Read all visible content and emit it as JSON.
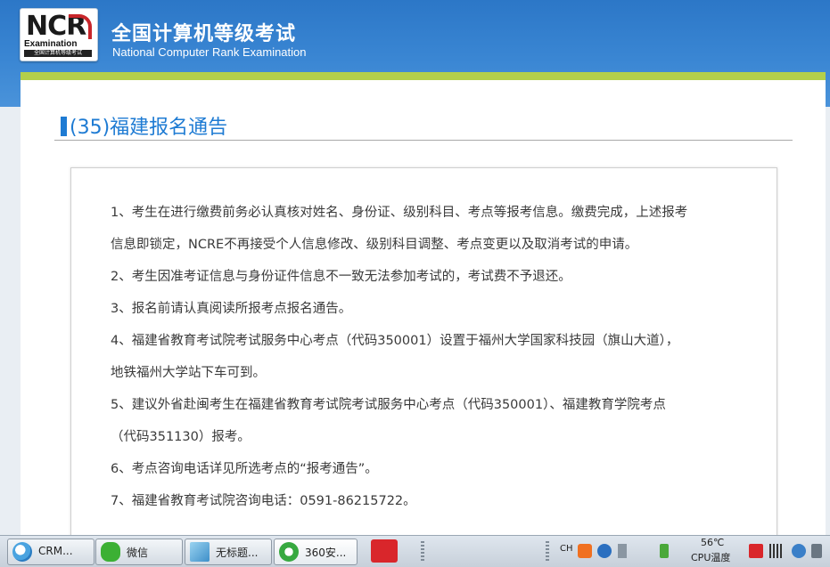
{
  "header": {
    "logo_text": "NCR",
    "logo_sub": "Examination",
    "logo_strip": "全国计算机等级考试",
    "title_cn": "全国计算机等级考试",
    "title_en": "National Computer Rank Examination"
  },
  "page": {
    "title": "(35)福建报名通告"
  },
  "notice": {
    "lines": [
      "1、考生在进行缴费前务必认真核对姓名、身份证、级别科目、考点等报考信息。缴费完成，上述报考",
      "信息即锁定，NCRE不再接受个人信息修改、级别科目调整、考点变更以及取消考试的申请。",
      "2、考生因准考证信息与身份证件信息不一致无法参加考试的，考试费不予退还。",
      "3、报名前请认真阅读所报考点报名通告。",
      "4、福建省教育考试院考试服务中心考点（代码350001）设置于福州大学国家科技园（旗山大道），",
      "地铁福州大学站下车可到。",
      "5、建议外省赴闽考生在福建省教育考试院考试服务中心考点（代码350001）、福建教育学院考点",
      "（代码351130）报考。",
      "6、考点咨询电话详见所选考点的“报考通告”。",
      "7、福建省教育考试院咨询电话：0591-86215722。"
    ]
  },
  "taskbar": {
    "items": [
      {
        "label": "CRM...",
        "icon": "crm-icon"
      },
      {
        "label": "微信",
        "icon": "wechat-icon"
      },
      {
        "label": "无标题...",
        "icon": "notepad-icon"
      },
      {
        "label": "360安...",
        "icon": "360-browser-icon"
      }
    ],
    "ime": "CH",
    "temp": "56℃",
    "cpu_label": "CPU温度"
  },
  "colors": {
    "header_blue": "#2c77c7",
    "accent_green": "#b3cf4a",
    "title_blue": "#1e7bd3"
  }
}
